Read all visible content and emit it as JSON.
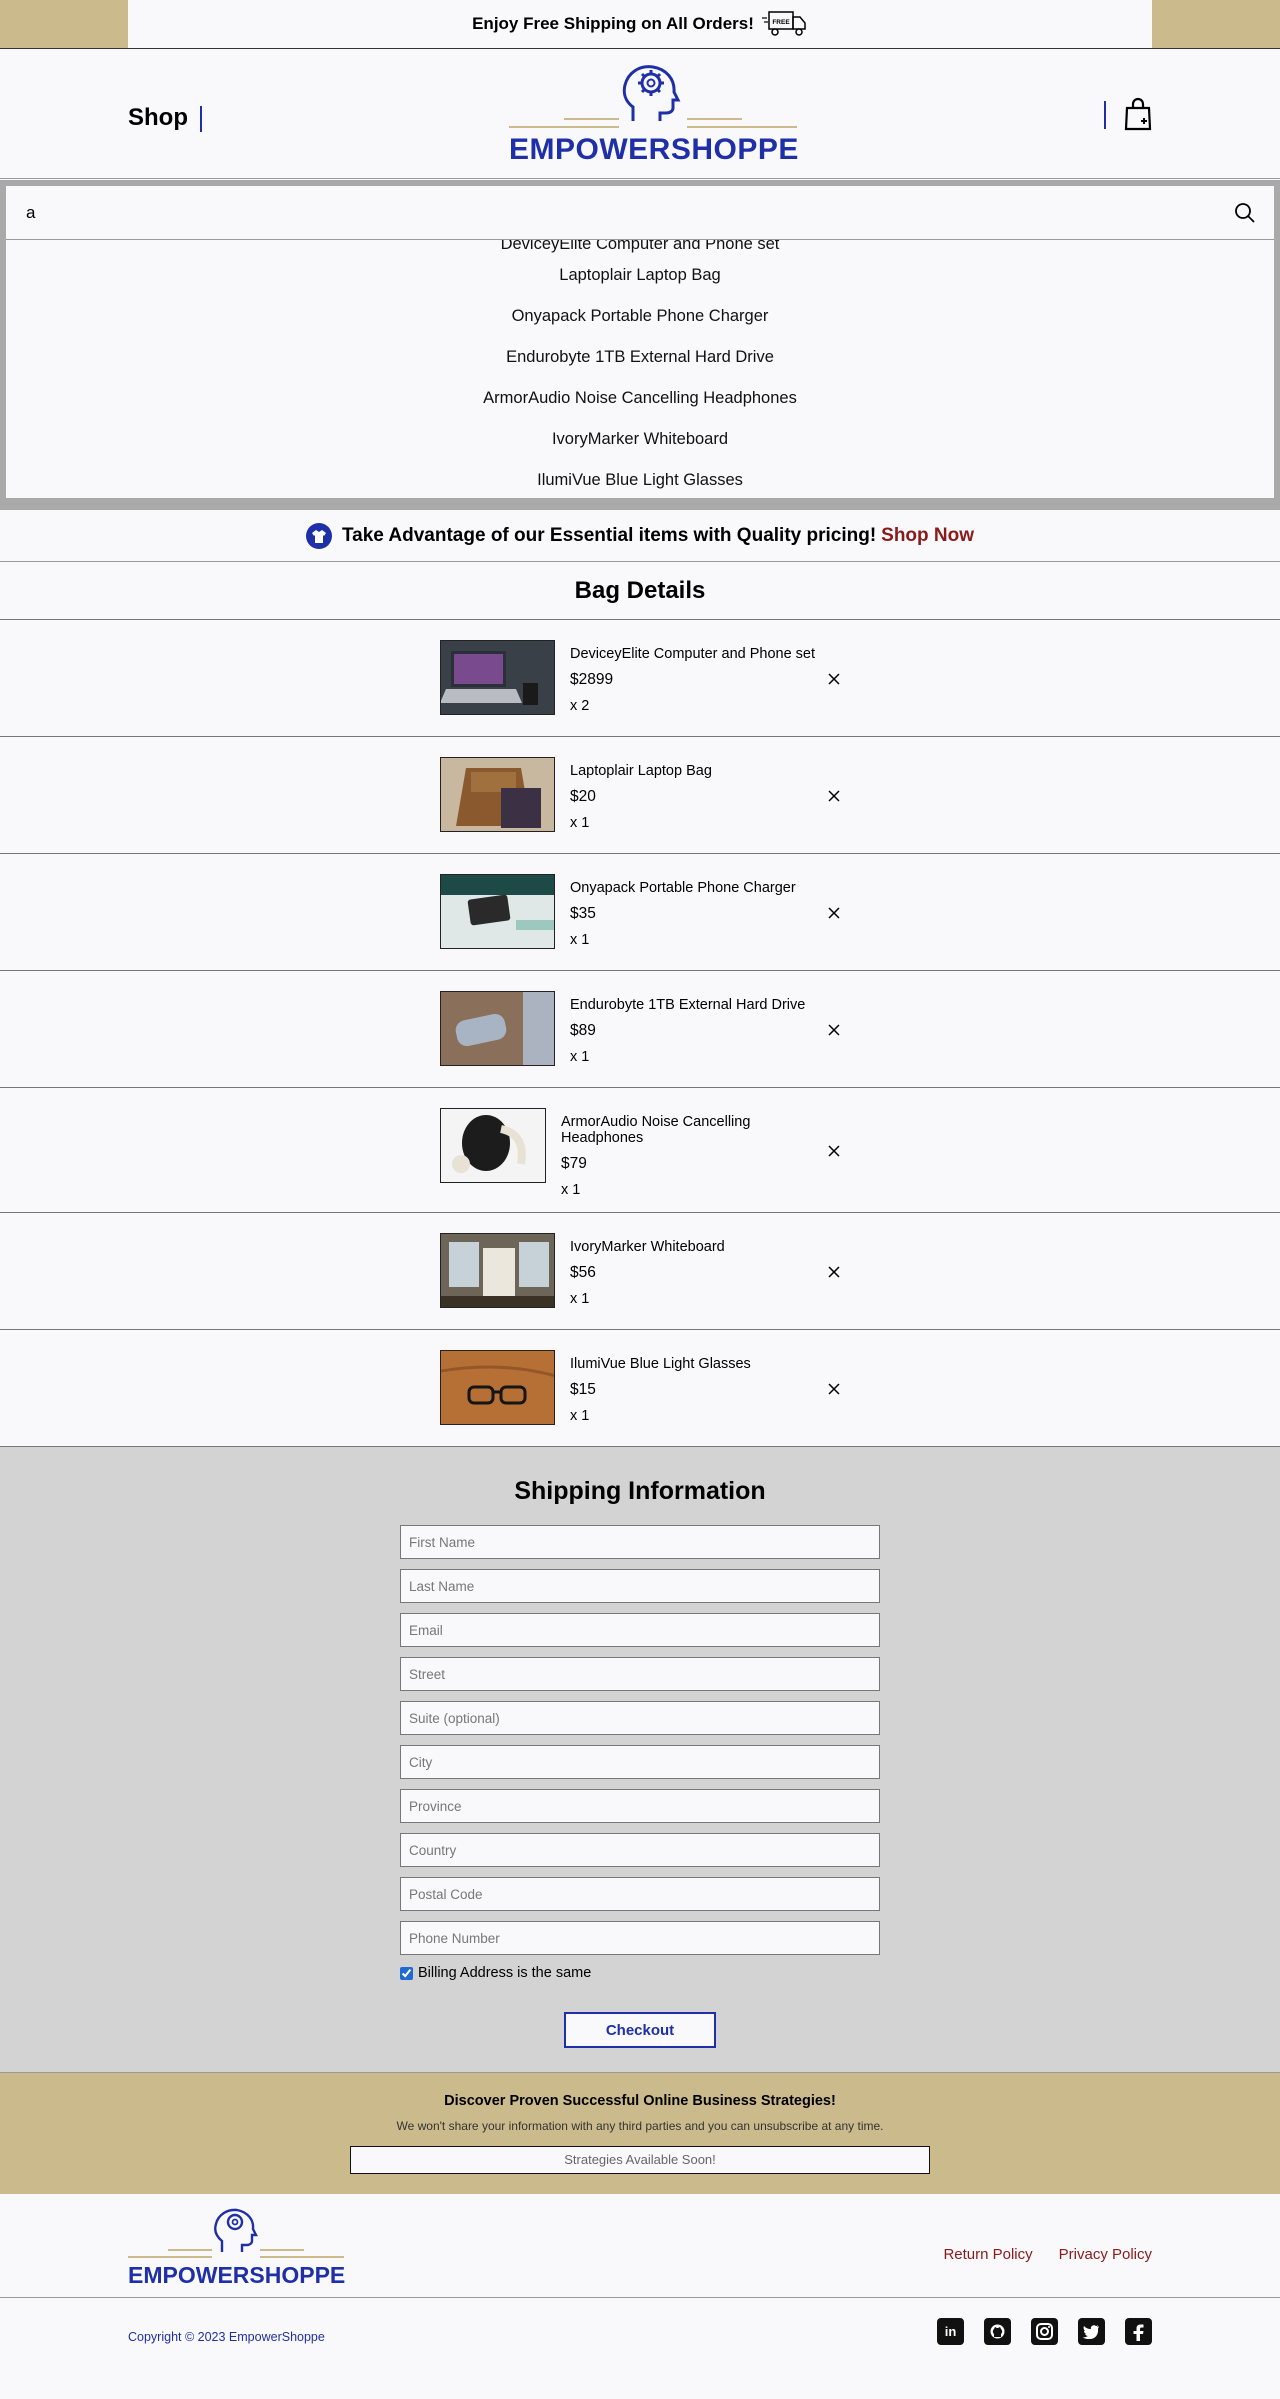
{
  "announcement": {
    "text": "Enjoy Free Shipping on All Orders!",
    "truck_label": "FREE"
  },
  "header": {
    "shop_label": "Shop",
    "logo_text": "EMPOWERSHOPPE"
  },
  "search": {
    "value": "a",
    "suggestions": [
      "DeviceyElite Computer and Phone set",
      "Laptoplair Laptop Bag",
      "Onyapack Portable Phone Charger",
      "Endurobyte 1TB External Hard Drive",
      "ArmorAudio Noise Cancelling Headphones",
      "IvoryMarker Whiteboard",
      "IlumiVue Blue Light Glasses"
    ]
  },
  "promo": {
    "text": "Take Advantage of our Essential items with Quality pricing!",
    "link": "Shop Now"
  },
  "bag": {
    "title": "Bag Details",
    "items": [
      {
        "name": "DeviceyElite Computer and Phone set",
        "price": "$2899",
        "qty": "x 2"
      },
      {
        "name": "Laptoplair Laptop Bag",
        "price": "$20",
        "qty": "x 1"
      },
      {
        "name": "Onyapack Portable Phone Charger",
        "price": "$35",
        "qty": "x 1"
      },
      {
        "name": "Endurobyte 1TB External Hard Drive",
        "price": "$89",
        "qty": "x 1"
      },
      {
        "name": "ArmorAudio Noise Cancelling Headphones",
        "price": "$79",
        "qty": "x 1"
      },
      {
        "name": "IvoryMarker Whiteboard",
        "price": "$56",
        "qty": "x 1"
      },
      {
        "name": "IlumiVue Blue Light Glasses",
        "price": "$15",
        "qty": "x 1"
      }
    ]
  },
  "shipping": {
    "title": "Shipping Information",
    "fields": {
      "first_name": "First Name",
      "last_name": "Last Name",
      "email": "Email",
      "street": "Street",
      "suite": "Suite (optional)",
      "city": "City",
      "province": "Province",
      "country": "Country",
      "postal": "Postal Code",
      "phone": "Phone Number"
    },
    "billing_label": "Billing Address is the same",
    "checkout_label": "Checkout"
  },
  "newsletter": {
    "title": "Discover Proven Successful Online Business Strategies!",
    "subtitle": "We won't share your information with any third parties and you can unsubscribe at any time.",
    "placeholder": "Strategies Available Soon!"
  },
  "footer": {
    "logo_text": "EMPOWERSHOPPE",
    "links": [
      "Return Policy",
      "Privacy Policy"
    ],
    "copyright": "Copyright © 2023 EmpowerShoppe",
    "socials": [
      "linkedin-icon",
      "github-icon",
      "instagram-icon",
      "twitter-icon",
      "facebook-icon"
    ]
  },
  "colors": {
    "brand_blue": "#1f2fa8",
    "gold": "#cbbb8c",
    "link_red": "#8b1a1a",
    "bg": "#f9f9fc"
  }
}
